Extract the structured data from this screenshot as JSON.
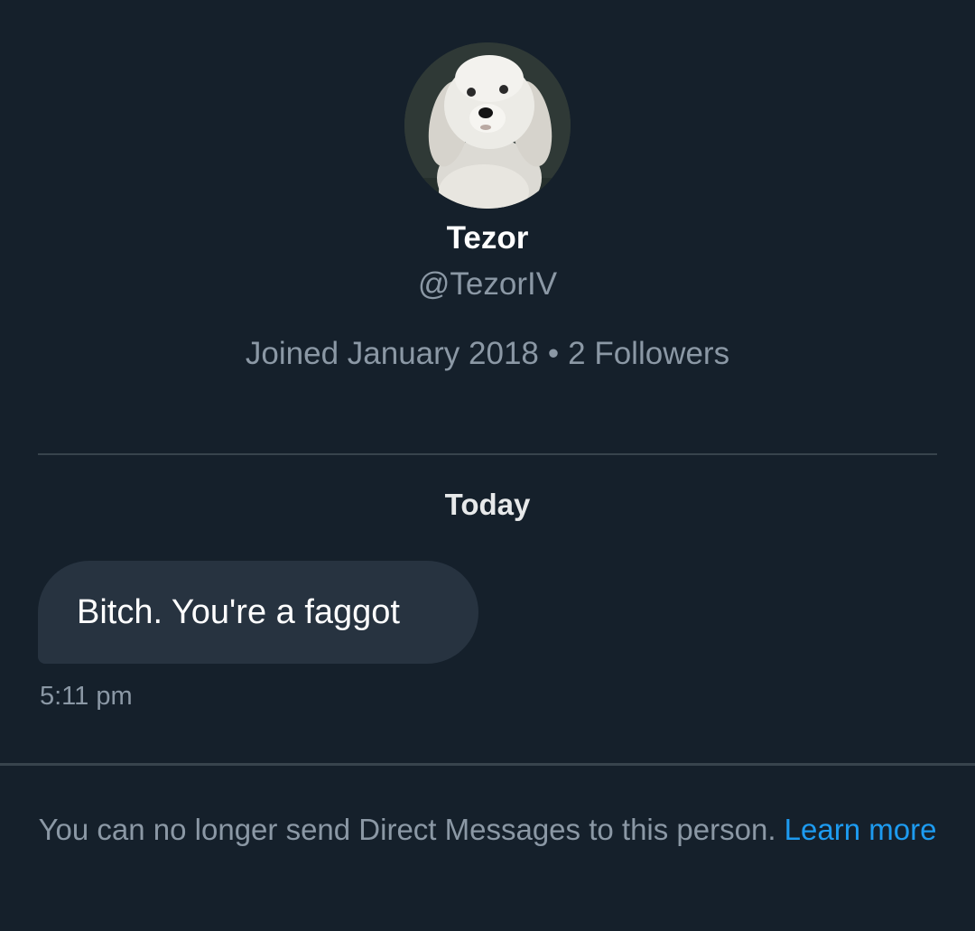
{
  "profile": {
    "avatar_icon": "dog-photo-avatar",
    "display_name": "Tezor",
    "handle": "@TezorIV",
    "joined": "Joined January 2018",
    "separator": "•",
    "followers": "2 Followers"
  },
  "conversation": {
    "day_label": "Today",
    "messages": [
      {
        "text": "Bitch. You're a faggot",
        "time": "5:11 pm"
      }
    ]
  },
  "footer": {
    "notice_text": "You can no longer send Direct Messages to this person.",
    "link_text": "Learn more",
    "link_color": "#1d9bf0"
  },
  "colors": {
    "background": "#15202b",
    "bubble": "#273340",
    "secondary_text": "#8b98a5",
    "divider": "#38444d"
  }
}
